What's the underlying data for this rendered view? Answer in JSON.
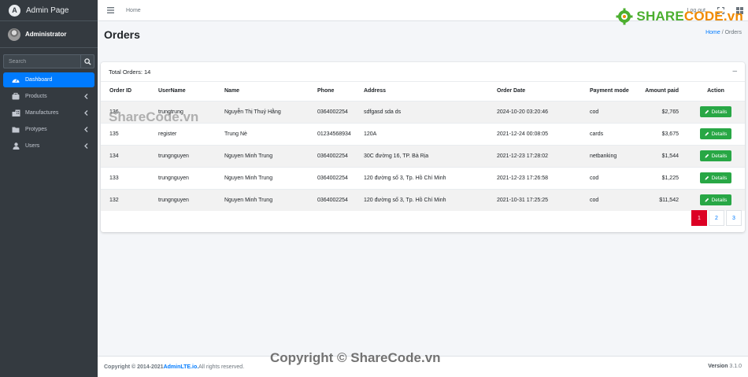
{
  "brand": {
    "title": "Admin Page",
    "logo_letter": "A"
  },
  "user": {
    "name": "Administrator"
  },
  "search": {
    "placeholder": "Search"
  },
  "sidebar": {
    "items": [
      {
        "label": "Dashboard",
        "icon": "dashboard-icon",
        "active": true
      },
      {
        "label": "Products",
        "icon": "briefcase-icon"
      },
      {
        "label": "Manufactures",
        "icon": "building-icon"
      },
      {
        "label": "Protypes",
        "icon": "folder-icon"
      },
      {
        "label": "Users",
        "icon": "user-icon"
      }
    ]
  },
  "topbar": {
    "home": "Home",
    "logout": "Log out"
  },
  "header": {
    "title": "Orders",
    "breadcrumb_home": "Home",
    "breadcrumb_sep": " / ",
    "breadcrumb_current": "Orders"
  },
  "card": {
    "total": "Total Orders: 14",
    "collapse_symbol": "–",
    "columns": [
      "Order ID",
      "UserName",
      "Name",
      "Phone",
      "Address",
      "Order Date",
      "Payment mode",
      "Amount paid",
      "Action"
    ],
    "details_label": "Details",
    "rows": [
      {
        "id": "136",
        "username": "trungtrung",
        "name": "Nguyễn Thị Thuý Hằng",
        "phone": "0364002254",
        "address": "sdfgasd sda ds",
        "date": "2024-10-20 03:20:46",
        "payment": "cod",
        "amount": "$2,765"
      },
      {
        "id": "135",
        "username": "register",
        "name": "Trung Nè",
        "phone": "01234568934",
        "address": "120A",
        "date": "2021-12-24 00:08:05",
        "payment": "cards",
        "amount": "$3,675"
      },
      {
        "id": "134",
        "username": "trungnguyen",
        "name": "Nguyen Minh Trung",
        "phone": "0364002254",
        "address": "30C đường 16, TP. Bà Rịa",
        "date": "2021-12-23 17:28:02",
        "payment": "netbanking",
        "amount": "$1,544"
      },
      {
        "id": "133",
        "username": "trungnguyen",
        "name": "Nguyen Minh Trung",
        "phone": "0364002254",
        "address": "120 đường số 3, Tp. Hồ Chí Minh",
        "date": "2021-12-23 17:26:58",
        "payment": "cod",
        "amount": "$1,225"
      },
      {
        "id": "132",
        "username": "trungnguyen",
        "name": "Nguyen Minh Trung",
        "phone": "0364002254",
        "address": "120 đường số 3, Tp. Hồ Chí Minh",
        "date": "2021-10-31 17:25:25",
        "payment": "cod",
        "amount": "$11,542"
      }
    ],
    "pages": [
      "1",
      "2",
      "3"
    ]
  },
  "footer": {
    "copyright": "Copyright © 2014-2021 ",
    "brand": "AdminLTE.io.",
    "rights": " All rights reserved.",
    "version_label": "Version",
    "version": " 3.1.0"
  },
  "watermark": {
    "logo_main": "SHARE",
    "logo_accent": "CODE.vn",
    "mid": "ShareCode.vn",
    "bottom": "Copyright © ShareCode.vn"
  },
  "colors": {
    "sidebar": "#343a40",
    "accent": "#007bff",
    "success": "#28a745",
    "page_active": "#dc0024"
  }
}
